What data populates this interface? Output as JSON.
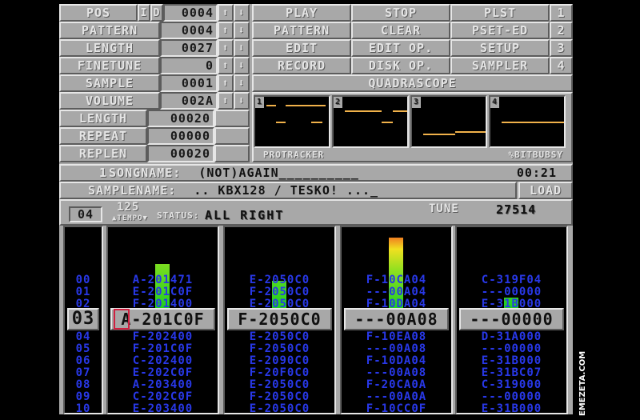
{
  "panel": {
    "pos_label": "POS",
    "i_label": "I",
    "d_label": "D",
    "pos_value": "0004",
    "pattern_label": "PATTERN",
    "pattern_value": "0004",
    "length_label": "LENGTH",
    "length_value": "0027",
    "finetune_label": "FINETUNE",
    "finetune_value": "0",
    "sample_label": "SAMPLE",
    "sample_value": "0001",
    "volume_label": "VOLUME",
    "volume_value": "002A",
    "slength_label": "LENGTH",
    "slength_value": "00020",
    "repeat_label": "REPEAT",
    "repeat_value": "00000",
    "replen_label": "REPLEN",
    "replen_value": "00020",
    "up_arrow": "⬆",
    "down_arrow": "⬇"
  },
  "menu": {
    "play": "PLAY",
    "stop": "STOP",
    "plst": "PLST",
    "num1": "1",
    "pattern": "PATTERN",
    "clear": "CLEAR",
    "psetted": "PSET-ED",
    "num2": "2",
    "edit": "EDIT",
    "editop": "EDIT OP.",
    "setup": "SETUP",
    "num3": "3",
    "record": "RECORD",
    "diskop": "DISK OP.",
    "sampler": "SAMPLER",
    "num4": "4"
  },
  "scope": {
    "title": "QUADRASCOPE",
    "channels": [
      "1",
      "2",
      "3",
      "4"
    ],
    "footer_left": "PROTRACKER",
    "footer_right": "%BITBUBSY"
  },
  "song": {
    "number": "1",
    "label": "SONGNAME:",
    "name": "(NOT)AGAIN__________",
    "time": "00:21"
  },
  "sample_bar": {
    "label": "SAMPLENAME:",
    "name": ".. KBX128 / TESKO! ..._",
    "load": "LOAD"
  },
  "status": {
    "octave": "04",
    "tempo": "125",
    "tempo_label": "▲TEMPO▼",
    "status_label": "STATUS:",
    "status_text": "ALL RIGHT",
    "tune_label": "TUNE",
    "tune_value": "27514"
  },
  "pattern": {
    "row_numbers_top": [
      "00",
      "01",
      "02"
    ],
    "current_row": "03",
    "row_numbers_bottom": [
      "04",
      "05",
      "06",
      "07",
      "08",
      "09",
      "10"
    ],
    "channels": [
      {
        "top": [
          "A-201471",
          "E-201C0F",
          "F-201400"
        ],
        "current": "A-201C0F",
        "bottom": [
          "F-202400",
          "F-201C0F",
          "C-202400",
          "E-202C0F",
          "A-203400",
          "C-202C0F",
          "E-203400"
        ],
        "vu_level": 0.55
      },
      {
        "top": [
          "E-2050C0",
          "F-2050C0",
          "E-2050C0"
        ],
        "current": "F-2050C0",
        "bottom": [
          "E-2050C0",
          "F-2050C0",
          "E-2090C0",
          "F-20F0C0",
          "E-2050C0",
          "F-2050C0",
          "E-2050C0"
        ],
        "vu_level": 0.34
      },
      {
        "top": [
          "F-10CA04",
          "---00A04",
          "F-10DA04"
        ],
        "current": "---00A08",
        "bottom": [
          "F-10EA08",
          "---00A08",
          "F-10DA04",
          "---00A08",
          "F-20CA0A",
          "---00A0A",
          "F-10CC0F"
        ],
        "vu_level": 0.88
      },
      {
        "top": [
          "C-319F04",
          "---00000",
          "E-31B000"
        ],
        "current": "---00000",
        "bottom": [
          "D-31A000",
          "---00000",
          "E-31B000",
          "E-31BC07",
          "C-319000",
          "---00000",
          "E-31B000"
        ],
        "vu_level": 0.13
      }
    ]
  },
  "watermark": "EMEZETA.COM",
  "colors": {
    "panel": "#a8a8a8",
    "pattern_text": "#2838e8",
    "scope_line": "#f0b14a"
  }
}
